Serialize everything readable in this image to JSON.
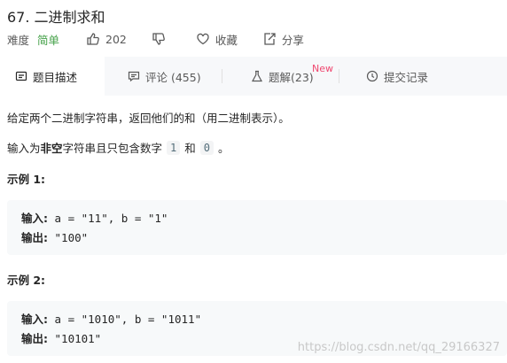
{
  "problem": {
    "title": "67. 二进制求和",
    "difficulty_label": "难度",
    "difficulty_value": "简单",
    "likes": "202",
    "favorite_label": "收藏",
    "share_label": "分享"
  },
  "tabs": [
    {
      "label": "题目描述",
      "icon": "description-icon"
    },
    {
      "label": "评论 (455)",
      "icon": "comment-icon"
    },
    {
      "label": "题解(23)",
      "icon": "flask-icon",
      "badge": "New"
    },
    {
      "label": "提交记录",
      "icon": "clock-icon"
    }
  ],
  "description": {
    "line1": "给定两个二进制字符串，返回他们的和（用二进制表示）。",
    "line2_prefix": "输入为",
    "line2_bold": "非空",
    "line2_mid": "字符串且只包含数字",
    "digit1": "1",
    "line2_and": "和",
    "digit0": "0",
    "line2_end": "。"
  },
  "examples": [
    {
      "title": "示例 1:",
      "input_label": "输入:",
      "input_value": " a = \"11\", b = \"1\"",
      "output_label": "输出:",
      "output_value": " \"100\""
    },
    {
      "title": "示例 2:",
      "input_label": "输入:",
      "input_value": " a = \"1010\", b = \"1011\"",
      "output_label": "输出:",
      "output_value": " \"10101\""
    }
  ],
  "watermark": "https://blog.csdn.net/qq_29166327",
  "colors": {
    "easy": "#43a047",
    "new_badge": "#ef476f",
    "tabs_bg": "#f7f8fa",
    "code_bg": "#f7f9fa"
  }
}
